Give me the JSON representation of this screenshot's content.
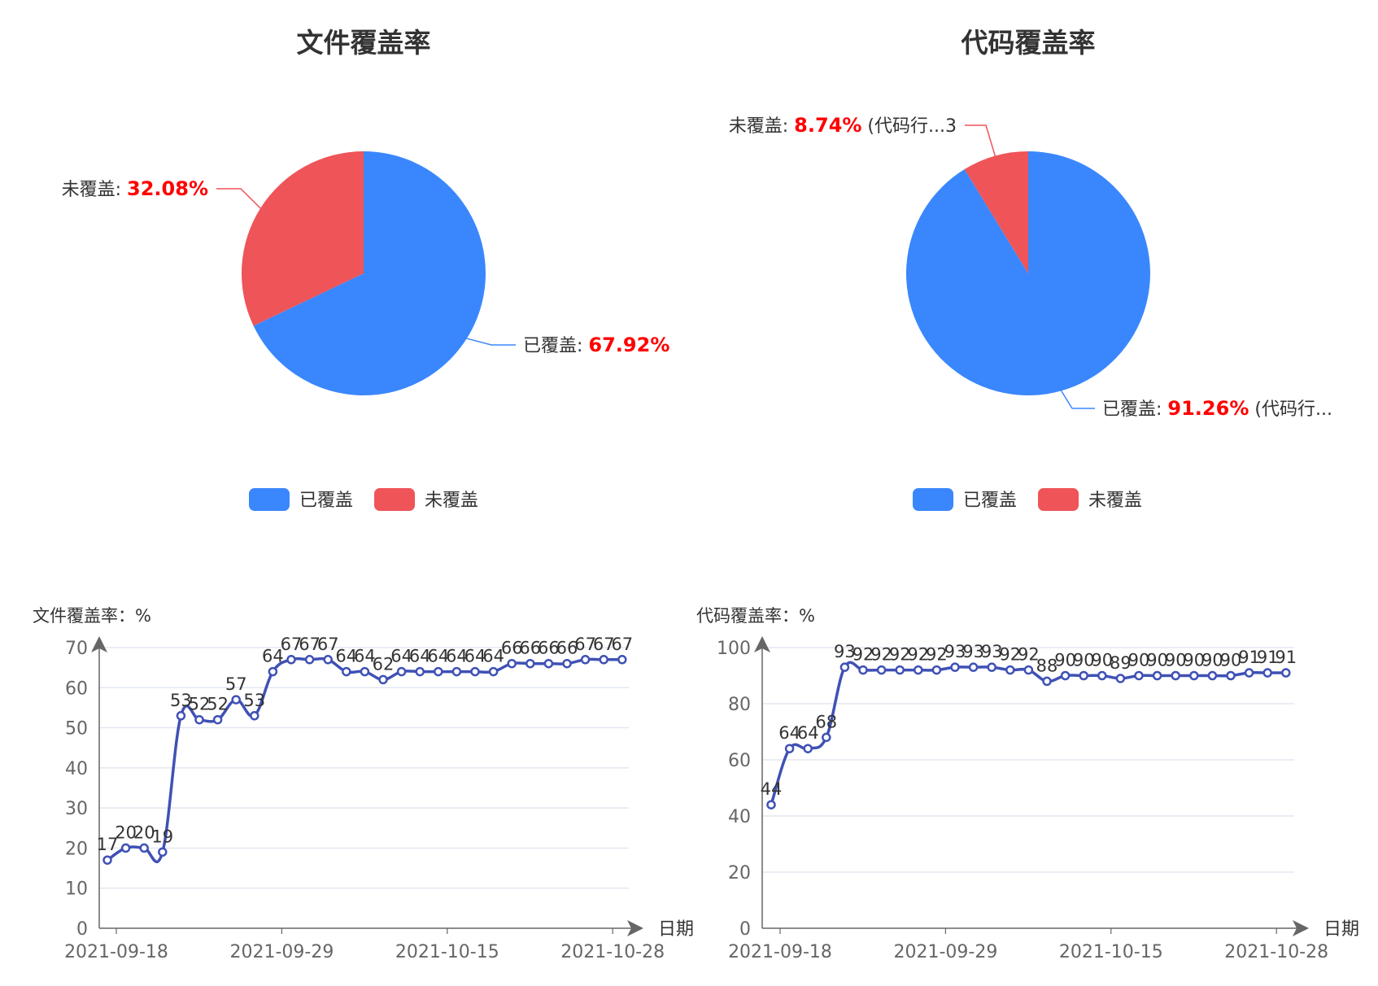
{
  "colors": {
    "covered": "#3a87fd",
    "uncovered": "#ef5458",
    "line": "#3f51b5",
    "label_value": "#ff0000",
    "axis": "#666666",
    "grid": "#dde2ee",
    "text": "#333333"
  },
  "chart_data": [
    {
      "type": "pie",
      "title": "文件覆盖率",
      "slices": [
        {
          "name": "已覆盖",
          "value": 67.92,
          "label_prefix": "已覆盖: ",
          "label_value": "67.92%",
          "label_suffix": ""
        },
        {
          "name": "未覆盖",
          "value": 32.08,
          "label_prefix": "未覆盖: ",
          "label_value": "32.08%",
          "label_suffix": ""
        }
      ],
      "legend": [
        "已覆盖",
        "未覆盖"
      ],
      "legend_position": "bottom"
    },
    {
      "type": "pie",
      "title": "代码覆盖率",
      "slices": [
        {
          "name": "已覆盖",
          "value": 91.26,
          "label_prefix": "已覆盖: ",
          "label_value": "91.26%",
          "label_suffix": " (代码行..."
        },
        {
          "name": "未覆盖",
          "value": 8.74,
          "label_prefix": "未覆盖: ",
          "label_value": "8.74%",
          "label_suffix": " (代码行...3"
        }
      ],
      "legend": [
        "已覆盖",
        "未覆盖"
      ],
      "legend_position": "bottom"
    },
    {
      "type": "line",
      "ylabel": "文件覆盖率：%",
      "xlabel": "日期",
      "ylim": [
        0,
        70
      ],
      "yticks": [
        0,
        10,
        20,
        30,
        40,
        50,
        60,
        70
      ],
      "xtick_labels": [
        "2021-09-18",
        "2021-09-29",
        "2021-10-15",
        "2021-10-28"
      ],
      "xtick_positions": [
        0,
        9,
        18,
        27
      ],
      "values": [
        17,
        20,
        20,
        19,
        53,
        52,
        52,
        57,
        53,
        64,
        67,
        67,
        67,
        64,
        64,
        62,
        64,
        64,
        64,
        64,
        64,
        64,
        66,
        66,
        66,
        66,
        67,
        67,
        67
      ],
      "point_labels": [
        "17",
        "20",
        "20",
        "19",
        "53",
        "52",
        "52",
        "57",
        "53",
        "64",
        "67",
        "67",
        "67",
        "64",
        "64",
        "62",
        "64",
        "64",
        "64",
        "64",
        "64",
        "64",
        "66",
        "66",
        "66",
        "66",
        "67",
        "67",
        "67"
      ],
      "grid": true
    },
    {
      "type": "line",
      "ylabel": "代码覆盖率：%",
      "xlabel": "日期",
      "ylim": [
        0,
        100
      ],
      "yticks": [
        0,
        20,
        40,
        60,
        80,
        100
      ],
      "xtick_labels": [
        "2021-09-18",
        "2021-09-29",
        "2021-10-15",
        "2021-10-28"
      ],
      "xtick_positions": [
        0,
        9,
        18,
        27
      ],
      "values": [
        44,
        64,
        64,
        68,
        93,
        92,
        92,
        92,
        92,
        92,
        93,
        93,
        93,
        92,
        92,
        88,
        90,
        90,
        90,
        89,
        90,
        90,
        90,
        90,
        90,
        90,
        91,
        91,
        91
      ],
      "point_labels": [
        "44",
        "64",
        "64",
        "68",
        "93",
        "92",
        "92",
        "92",
        "92",
        "92",
        "93",
        "93",
        "93",
        "92",
        "92",
        "88",
        "90",
        "90",
        "90",
        "89",
        "90",
        "90",
        "90",
        "90",
        "90",
        "90",
        "91",
        "91",
        "91"
      ],
      "grid": true
    }
  ]
}
